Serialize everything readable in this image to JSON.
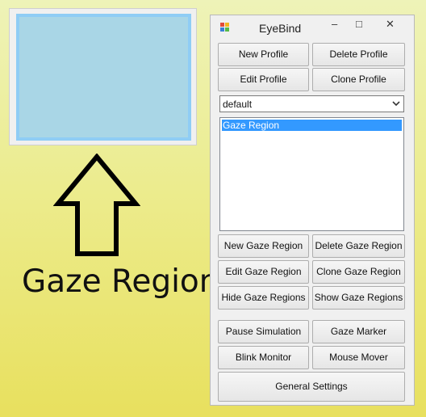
{
  "annotation": {
    "caption": "Gaze Region"
  },
  "window": {
    "title": "EyeBind",
    "controls": {
      "minimize": "–",
      "maximize": "□",
      "close": "✕"
    }
  },
  "profile_buttons": {
    "new": "New Profile",
    "delete": "Delete Profile",
    "edit": "Edit Profile",
    "clone": "Clone Profile"
  },
  "profile_select": {
    "value": "default"
  },
  "region_list": {
    "items": [
      "Gaze Region"
    ]
  },
  "region_buttons": {
    "new": "New Gaze Region",
    "delete": "Delete Gaze Region",
    "edit": "Edit Gaze Region",
    "clone": "Clone Gaze Region",
    "hide": "Hide Gaze Regions",
    "show": "Show Gaze Regions"
  },
  "tool_buttons": {
    "pause": "Pause Simulation",
    "marker": "Gaze Marker",
    "blink": "Blink Monitor",
    "mouse": "Mouse Mover",
    "settings": "General Settings"
  },
  "colors": {
    "region_fill": "#a9d6e6",
    "region_border": "#8fcdf5",
    "selection": "#3399ff",
    "desktop_bottom": "#e8e05e"
  }
}
